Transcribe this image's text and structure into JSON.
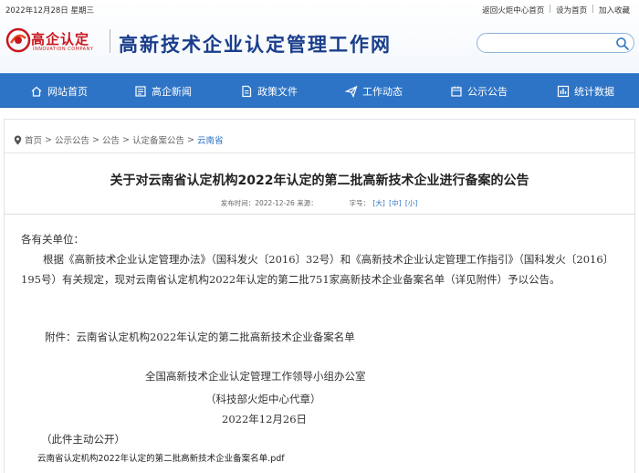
{
  "topbar": {
    "date": "2022年12月28日 星期三",
    "links": [
      "返回火炬中心首页",
      "设为首页",
      "加入收藏"
    ]
  },
  "logo": {
    "name": "高企认定",
    "sub": "INNOVATION COMPANY",
    "color": "#c8161d"
  },
  "site_title": "高新技术企业认定管理工作网",
  "search": {
    "placeholder": ""
  },
  "nav": {
    "items": [
      {
        "label": "网站首页",
        "icon": "home-icon"
      },
      {
        "label": "高企新闻",
        "icon": "news-icon"
      },
      {
        "label": "政策文件",
        "icon": "document-icon"
      },
      {
        "label": "工作动态",
        "icon": "send-icon"
      },
      {
        "label": "公示公告",
        "icon": "notice-icon"
      },
      {
        "label": "统计数据",
        "icon": "chart-icon"
      }
    ],
    "color": "#2e74c6"
  },
  "breadcrumb": {
    "items": [
      "首页",
      "公示公告",
      "公告",
      "认定备案公告"
    ],
    "current": "云南省",
    "separator": ">"
  },
  "article": {
    "title": "关于对云南省认定机构2022年认定的第二批高新技术企业进行备案的公告",
    "meta_date_label": "发布时间：2022-12-26 来源：",
    "meta_fontsize_label": "字号：",
    "font_sizes": [
      "[大]",
      "[中]",
      "[小]"
    ],
    "salutation": "各有关单位：",
    "paragraph": "根据《高新技术企业认定管理办法》（国科发火〔2016〕32号）和《高新技术企业认定管理工作指引》（国科发火〔2016〕195号）有关规定，现对云南省认定机构2022年认定的第二批751家高新技术企业备案名单（详见附件）予以公告。",
    "attachment": "附件：云南省认定机构2022年认定的第二批高新技术企业备案名单",
    "signature_org": "全国高新技术企业认定管理工作领导小组办公室",
    "signature_agent": "（科技部火炬中心代章）",
    "signature_date": "2022年12月26日",
    "public_note": "（此件主动公开）",
    "pdf_link": "云南省认定机构2022年认定的第二批高新技术企业备案名单.pdf"
  }
}
